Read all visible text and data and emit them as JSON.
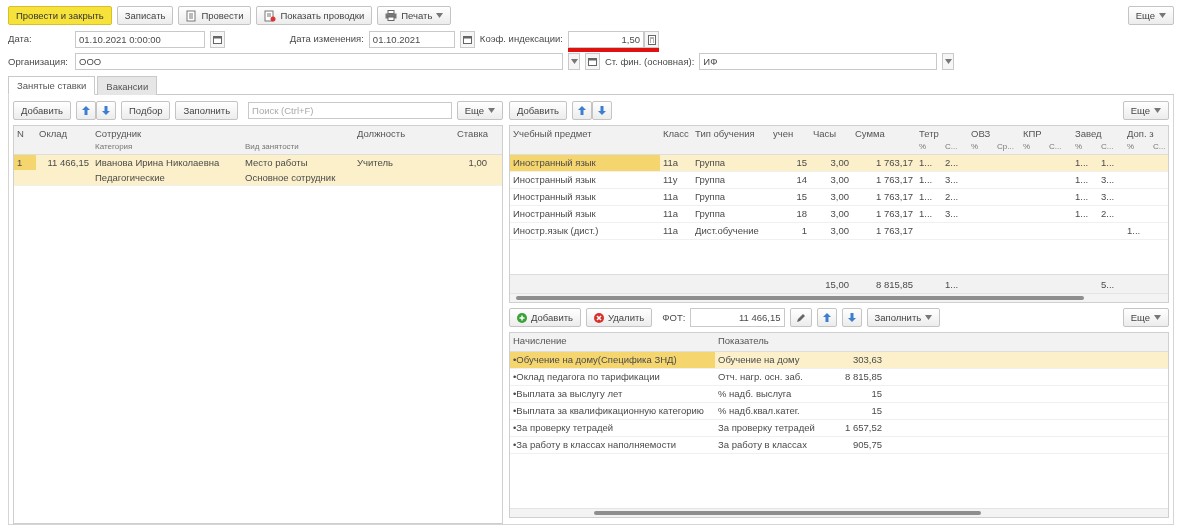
{
  "toolbar": {
    "buttons": [
      {
        "label": "Провести и закрыть",
        "kind": "primary"
      },
      {
        "label": "Записать",
        "kind": "plain"
      },
      {
        "label": "Провести",
        "kind": "post"
      },
      {
        "label": "Показать проводки",
        "kind": "postings"
      },
      {
        "label": "Печать",
        "kind": "print"
      }
    ],
    "more": "Еще"
  },
  "header": {
    "date_label": "Дата:",
    "date": "01.10.2021 0:00:00",
    "change_date_label": "Дата изменения:",
    "change_date": "01.10.2021",
    "coef_label": "Коэф. индексации:",
    "coef": "1,50",
    "coef_invalid": true,
    "org_label": "Организация:",
    "org": "ООО",
    "fin_label": "Ст. фин. (основная):",
    "fin": "ИФ"
  },
  "tabs": [
    {
      "label": "Занятые ставки",
      "selected": true
    },
    {
      "label": "Вакансии",
      "selected": false
    }
  ],
  "rates": {
    "add": "Добавить",
    "pick": "Подбор",
    "fill": "Заполнить",
    "search": {
      "placeholder": "Поиск (Ctrl+F)"
    },
    "more": "Еще",
    "columns": [
      {
        "label": "N"
      },
      {
        "label": "Оклад"
      },
      {
        "label": "Сотрудник",
        "sub": [
          "Категория",
          "Вид занятости"
        ]
      },
      {
        "label": "Должность"
      },
      {
        "label": "Ставка"
      }
    ],
    "rows": [
      {
        "selected": true,
        "number": "1",
        "salary": "11 466,15",
        "employee": "Иванова Ирина Николаевна",
        "employment": "Место работы",
        "category": "Педагогические",
        "staff_type": "Основное сотрудник",
        "position": "Учитель",
        "rate": "1,00"
      }
    ]
  },
  "load": {
    "add": "Добавить",
    "more": "Еще",
    "columns": [
      {
        "label": "Учебный предмет"
      },
      {
        "label": "Класс"
      },
      {
        "label": "Тип обучения"
      },
      {
        "label": "учен"
      },
      {
        "label": "Часы"
      },
      {
        "label": "Сумма"
      },
      {
        "label": "Тетр",
        "sub": [
          "%",
          "С..."
        ]
      },
      {
        "label": "ОВЗ",
        "sub": [
          "%",
          "Ср..."
        ]
      },
      {
        "label": "КПР",
        "sub": [
          "%",
          "С..."
        ]
      },
      {
        "label": "Завед",
        "sub": [
          "%",
          "С..."
        ]
      },
      {
        "label": "Доп. з",
        "sub": [
          "%",
          "С..."
        ]
      }
    ],
    "rows": [
      {
        "selected": true,
        "subject": "Иностранный язык",
        "class": "11а",
        "type": "Группа",
        "pupils": "15",
        "hours": "3,00",
        "sum": "1 763,17",
        "notebooks_pct": "1...",
        "notebooks_sum": "2...",
        "head_pct": "1...",
        "head_sum": "1..."
      },
      {
        "selected": false,
        "subject": "Иностранный язык",
        "class": "11у",
        "type": "Группа",
        "pupils": "14",
        "hours": "3,00",
        "sum": "1 763,17",
        "notebooks_pct": "1...",
        "notebooks_sum": "3...",
        "head_pct": "1...",
        "head_sum": "3..."
      },
      {
        "selected": false,
        "subject": "Иностранный язык",
        "class": "11а",
        "type": "Группа",
        "pupils": "15",
        "hours": "3,00",
        "sum": "1 763,17",
        "notebooks_pct": "1...",
        "notebooks_sum": "2...",
        "head_pct": "1...",
        "head_sum": "3..."
      },
      {
        "selected": false,
        "subject": "Иностранный язык",
        "class": "11а",
        "type": "Группа",
        "pupils": "18",
        "hours": "3,00",
        "sum": "1 763,17",
        "notebooks_pct": "1...",
        "notebooks_sum": "3...",
        "head_pct": "1...",
        "head_sum": "2..."
      },
      {
        "selected": false,
        "subject": "Иностр.язык (дист.)",
        "class": "11а",
        "type": "Дист.обучение",
        "pupils": "1",
        "hours": "3,00",
        "sum": "1 763,17",
        "extra_pct": "1..."
      }
    ],
    "totals": {
      "hours": "15,00",
      "sum": "8 815,85",
      "notebooks_sum": "1...",
      "head_sum": "5..."
    }
  },
  "accruals": {
    "add": "Добавить",
    "delete": "Удалить",
    "fot_label": "ФОТ:",
    "fot": "11 466,15",
    "fill": "Заполнить",
    "more": "Еще",
    "columns": [
      {
        "label": "Начисление"
      },
      {
        "label": "Показатель"
      }
    ],
    "rows": [
      {
        "selected": true,
        "accrual": "•Обучение на дому(Специфика ЗНД)",
        "indicator": "Обучение на дому",
        "value": "303,63"
      },
      {
        "selected": false,
        "accrual": "•Оклад педагога по тарификации",
        "indicator": "Отч. нагр. осн. заб.",
        "value": "8 815,85"
      },
      {
        "selected": false,
        "accrual": "•Выплата за выслугу лет",
        "indicator": "% надб. выслуга",
        "value": "15"
      },
      {
        "selected": false,
        "accrual": "•Выплата за квалификационную категорию",
        "indicator": "% надб.квал.катег.",
        "value": "15"
      },
      {
        "selected": false,
        "accrual": "•За проверку тетрадей",
        "indicator": "За проверку тетрадей",
        "value": "1 657,52"
      },
      {
        "selected": false,
        "accrual": "•За работу в классах наполняемости",
        "indicator": "За работу в классах",
        "value": "905,75"
      }
    ]
  }
}
